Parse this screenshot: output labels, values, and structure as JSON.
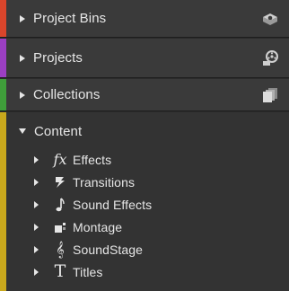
{
  "colors": {
    "project_bins": "#d9452b",
    "projects": "#9b3fc2",
    "collections": "#3f9e3a",
    "content": "#c9a81c"
  },
  "sections": [
    {
      "label": "Project Bins",
      "icon": "project-bins-icon",
      "expanded": false
    },
    {
      "label": "Projects",
      "icon": "projects-icon",
      "expanded": false
    },
    {
      "label": "Collections",
      "icon": "collections-icon",
      "expanded": false
    },
    {
      "label": "Content",
      "icon": null,
      "expanded": true
    }
  ],
  "content_items": [
    {
      "label": "Effects",
      "icon": "fx-icon"
    },
    {
      "label": "Transitions",
      "icon": "transitions-icon"
    },
    {
      "label": "Sound Effects",
      "icon": "music-note-icon"
    },
    {
      "label": "Montage",
      "icon": "montage-icon"
    },
    {
      "label": "SoundStage",
      "icon": "soundstage-icon"
    },
    {
      "label": "Titles",
      "icon": "titles-icon"
    }
  ]
}
